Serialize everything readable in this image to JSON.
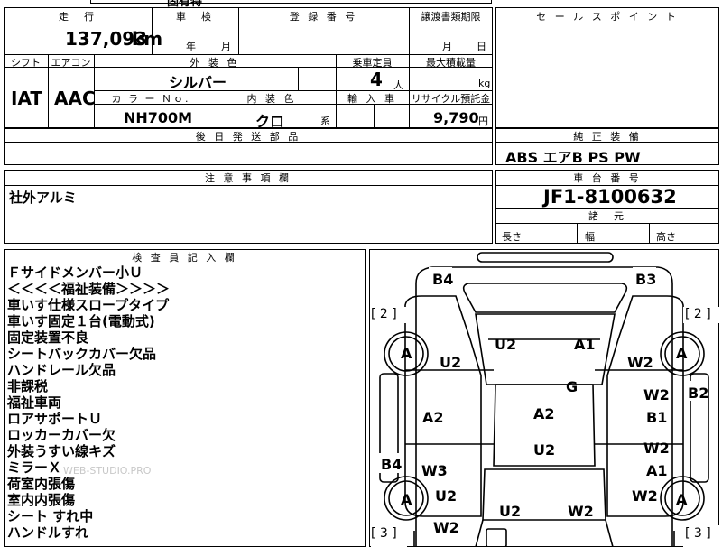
{
  "top_partial": {
    "text": "固有特"
  },
  "vehicle": {
    "mileage_header": "走　行",
    "mileage": "137,093",
    "mileage_unit": "km",
    "inspection_header": "車　検",
    "inspection_year_unit": "年",
    "inspection_month_unit": "月",
    "registration_header": "登 録 番 号",
    "transfer_header": "譲渡書類期限",
    "transfer_month_unit": "月",
    "transfer_day_unit": "日",
    "shift_header": "シフト",
    "shift": "IAT",
    "aircon_header": "エアコン",
    "aircon": "AAC",
    "exterior_color_header": "外 装 色",
    "exterior_color": "シルバー",
    "capacity_header": "乗車定員",
    "capacity": "4",
    "capacity_unit": "人",
    "max_load_header": "最大積載量",
    "max_load_unit": "kg",
    "color_no_header": "カ ラ ー Ｎｏ.",
    "color_no": "NH700M",
    "interior_color_header": "内 装 色",
    "interior_color": "クロ",
    "interior_suffix": "系",
    "import_header": "輸 入 車",
    "recycle_header": "リサイクル預託金",
    "recycle_fee": "9,790",
    "recycle_unit": "円",
    "later_parts_header": "後 日 発 送 部 品"
  },
  "sales_point": {
    "header": "セ ー ル ス ポ イ ン ト"
  },
  "equipment": {
    "header": "純 正 装 備",
    "items": "ABS  エアB  PS  PW"
  },
  "notes": {
    "header": "注 意 事 項 欄",
    "text": "社外アルミ"
  },
  "chassis": {
    "header": "車 台 番 号",
    "number": "JF1-8100632"
  },
  "dimensions": {
    "header": "諸　元",
    "length": "長さ",
    "width": "幅",
    "height": "高さ"
  },
  "inspector": {
    "header": "検 査 員 記 入 欄",
    "lines": [
      "Ｆサイドメンバー小Ｕ",
      "＜＜＜＜福祉装備＞＞＞＞",
      "車いす仕様スロープタイプ",
      "車いす固定１台(電動式)",
      "固定装置不良",
      "シートバックカバー欠品",
      "ハンドレール欠品",
      "非課税",
      "福祉車両",
      "ロアサポートＵ",
      "ロッカーカバー欠",
      "外装うすい線キズ",
      "ミラーＸ",
      "荷室内張傷",
      "室内内張傷",
      "シート すれ中",
      "ハンドルすれ"
    ],
    "watermark": "WEB-STUDIO.PRO"
  },
  "diagram": {
    "labels": {
      "b4_top": "B4",
      "b3_top": "B3",
      "bracket_left_top": "[ 2 ]",
      "bracket_right_top": "[ 2 ]",
      "bracket_left_bottom": "[ 3 ]",
      "bracket_right_bottom": "[ 3 ]",
      "wheel_fl": "A",
      "wheel_fr": "A",
      "wheel_rl": "A",
      "wheel_rr": "A",
      "u2_a": "U2",
      "a1_a": "A1",
      "u2_b": "U2",
      "w2_a": "W2",
      "g": "G",
      "w2_b": "W2",
      "b2": "B2",
      "a2_a": "A2",
      "a2_b": "A2",
      "b1": "B1",
      "u2_c": "U2",
      "w2_c": "W2",
      "b4_side": "B4",
      "w3": "W3",
      "a1_b": "A1",
      "u2_d": "U2",
      "w2_d": "W2",
      "u2_e": "U2",
      "w2_e": "W2",
      "w2_f": "W2"
    }
  }
}
